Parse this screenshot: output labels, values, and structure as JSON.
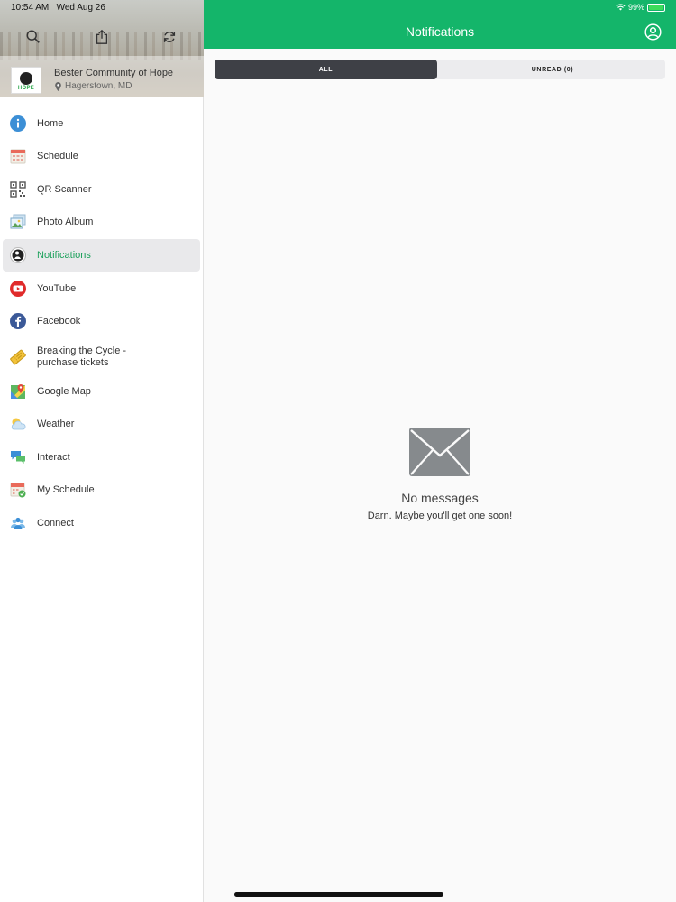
{
  "status_bar": {
    "time": "10:54 AM",
    "date": "Wed Aug 26",
    "battery_text": "99%"
  },
  "sidebar": {
    "tools": [
      {
        "icon": "search-icon"
      },
      {
        "icon": "share-icon"
      },
      {
        "icon": "refresh-icon"
      }
    ],
    "org": {
      "name": "Bester Community of Hope",
      "location": "Hagerstown, MD",
      "logo_text": "HOPE"
    },
    "items": [
      {
        "label": "Home",
        "icon": "info-icon",
        "active": false
      },
      {
        "label": "Schedule",
        "icon": "calendar-icon",
        "active": false
      },
      {
        "label": "QR Scanner",
        "icon": "qr-code-icon",
        "active": false
      },
      {
        "label": "Photo Album",
        "icon": "photo-icon",
        "active": false
      },
      {
        "label": "Notifications",
        "icon": "notifications-logo-icon",
        "active": true
      },
      {
        "label": "YouTube",
        "icon": "youtube-icon",
        "active": false
      },
      {
        "label": "Facebook",
        "icon": "facebook-icon",
        "active": false
      },
      {
        "label": "Breaking the Cycle - purchase tickets",
        "label_line1": "Breaking the Cycle -",
        "label_line2": "purchase tickets",
        "icon": "ticket-icon",
        "active": false
      },
      {
        "label": "Google Map",
        "icon": "map-icon",
        "active": false
      },
      {
        "label": "Weather",
        "icon": "weather-icon",
        "active": false
      },
      {
        "label": "Interact",
        "icon": "chat-icon",
        "active": false
      },
      {
        "label": "My Schedule",
        "icon": "calendar-check-icon",
        "active": false
      },
      {
        "label": "Connect",
        "icon": "people-icon",
        "active": false
      }
    ]
  },
  "header": {
    "title": "Notifications",
    "profile_icon": "user-circle-icon"
  },
  "tabs": {
    "all_label": "ALL",
    "unread_label": "UNREAD (0)",
    "selected": "ALL"
  },
  "empty_state": {
    "icon": "envelope-icon",
    "title": "No messages",
    "subtitle": "Darn. Maybe you'll get one soon!"
  },
  "colors": {
    "brand_green": "#14b56a",
    "active_text": "#1aa05a",
    "tab_selected": "#3e4046"
  }
}
